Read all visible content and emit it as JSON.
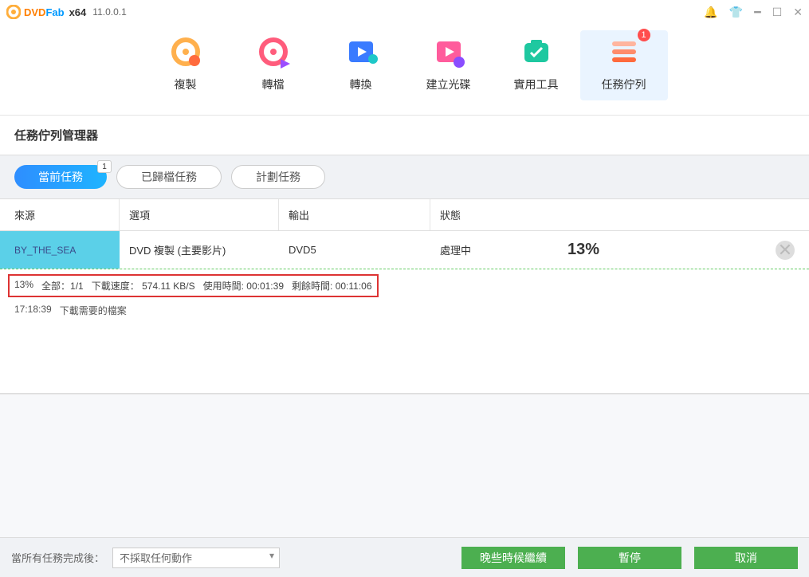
{
  "titlebar": {
    "brand_dvd": "DVD",
    "brand_fab": "Fab",
    "arch": "x64",
    "version": "11.0.0.1"
  },
  "categories": {
    "copy": {
      "label": "複製"
    },
    "ripper": {
      "label": "轉檔"
    },
    "convert": {
      "label": "轉換"
    },
    "creator": {
      "label": "建立光碟"
    },
    "util": {
      "label": "實用工具"
    },
    "queue": {
      "label": "任務佇列",
      "badge": "1"
    }
  },
  "section_title": "任務佇列管理器",
  "subtabs": {
    "current": {
      "label": "當前任務",
      "badge": "1"
    },
    "archived": {
      "label": "已歸檔任務"
    },
    "plan": {
      "label": "計劃任務"
    }
  },
  "columns": {
    "source": "來源",
    "option": "選項",
    "output": "輸出",
    "status": "狀態"
  },
  "task": {
    "source": "BY_THE_SEA",
    "option": "DVD 複製 (主要影片)",
    "output": "DVD5",
    "status": "處理中",
    "percent": "13%"
  },
  "detail": {
    "pct": "13%",
    "total_label": "全部：",
    "total_val": "1/1",
    "speed_label": "下載速度：",
    "speed_val": "574.11 KB/S",
    "elapsed_label": "使用時間:",
    "elapsed_val": "00:01:39",
    "remain_label": "剩餘時間:",
    "remain_val": "00:11:06"
  },
  "log": {
    "time": "17:18:39",
    "msg": "下載需要的檔案"
  },
  "footer": {
    "label": "當所有任務完成後：",
    "select_value": "不採取任何動作",
    "btn_later": "晚些時候繼續",
    "btn_pause": "暫停",
    "btn_cancel": "取消"
  }
}
